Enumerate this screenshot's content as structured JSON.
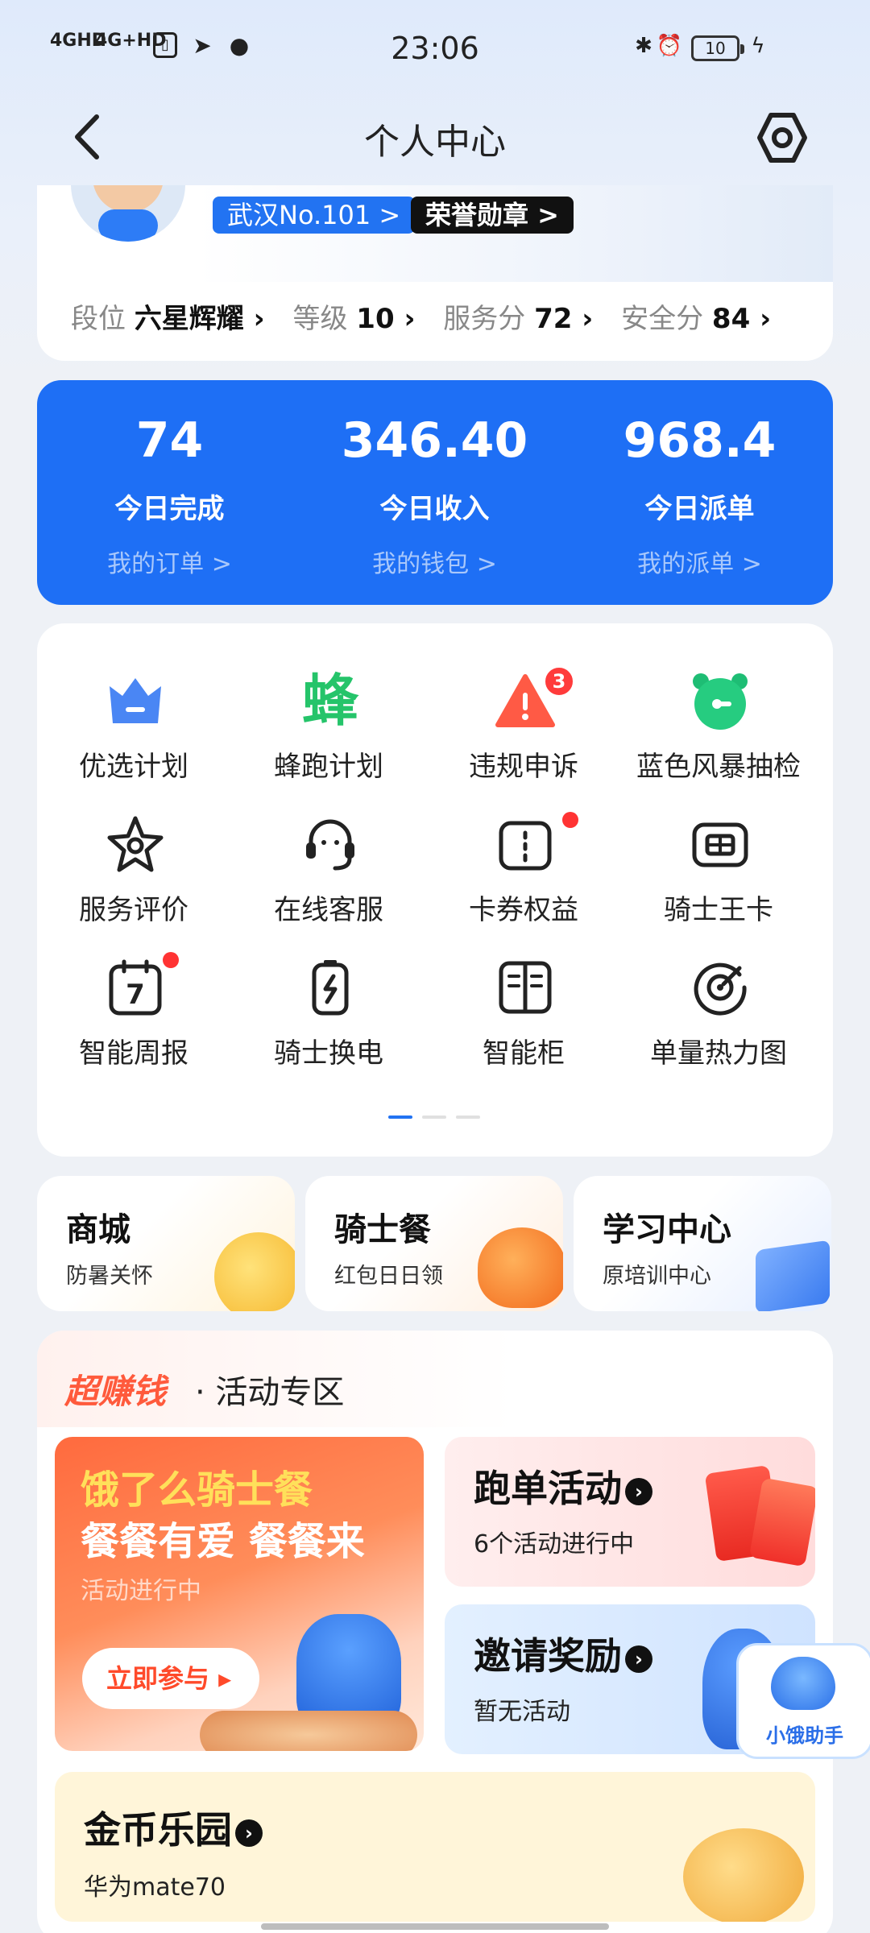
{
  "status_bar": {
    "signal1": "4GHD",
    "signal2": "4G+HD",
    "time": "23:06",
    "battery": "10"
  },
  "header": {
    "title": "个人中心"
  },
  "profile": {
    "city_badge": "武汉No.101 >",
    "honor_badge": "荣誉勋章 >",
    "stats": [
      {
        "label": "段位",
        "value": "六星辉耀"
      },
      {
        "label": "等级",
        "value": "10"
      },
      {
        "label": "服务分",
        "value": "72"
      },
      {
        "label": "安全分",
        "value": "84"
      }
    ]
  },
  "summary": [
    {
      "value": "74",
      "label": "今日完成",
      "link": "我的订单 >"
    },
    {
      "value": "346.40",
      "label": "今日收入",
      "link": "我的钱包 >"
    },
    {
      "value": "968.4",
      "label": "今日派单",
      "link": "我的派单 >"
    }
  ],
  "grid": [
    {
      "label": "优选计划",
      "icon": "crown-icon"
    },
    {
      "label": "蜂跑计划",
      "icon": "bee-char-icon",
      "glyph": "蜂"
    },
    {
      "label": "违规申诉",
      "icon": "warning-icon",
      "badge": "3"
    },
    {
      "label": "蓝色风暴抽检",
      "icon": "alarm-clock-icon"
    },
    {
      "label": "服务评价",
      "icon": "star-icon"
    },
    {
      "label": "在线客服",
      "icon": "headset-icon"
    },
    {
      "label": "卡券权益",
      "icon": "coupon-icon"
    },
    {
      "label": "骑士王卡",
      "icon": "card-icon"
    },
    {
      "label": "智能周报",
      "icon": "calendar-icon",
      "glyph": "7"
    },
    {
      "label": "骑士换电",
      "icon": "battery-swap-icon"
    },
    {
      "label": "智能柜",
      "icon": "locker-icon"
    },
    {
      "label": "单量热力图",
      "icon": "target-icon"
    }
  ],
  "tiles": [
    {
      "title": "商城",
      "sub": "防暑关怀"
    },
    {
      "title": "骑士餐",
      "sub": "红包日日领"
    },
    {
      "title": "学习中心",
      "sub": "原培训中心"
    }
  ],
  "activity": {
    "brand": "超赚钱",
    "title": "· 活动专区",
    "promo_main": {
      "line1": "饿了么骑士餐",
      "line2": "餐餐有爱 餐餐来",
      "status": "活动进行中",
      "button": "立即参与"
    },
    "promo_run": {
      "title": "跑单活动",
      "sub": "6个活动进行中"
    },
    "promo_invite": {
      "title": "邀请奖励",
      "sub": "暂无活动"
    },
    "promo_gold": {
      "title": "金币乐园",
      "sub": "华为mate70"
    }
  },
  "assistant": {
    "label": "小饿助手"
  },
  "colors": {
    "primary_blue": "#1e6ff5",
    "badge_red": "#ff3b3b",
    "activity_orange": "#ff5a3c"
  }
}
